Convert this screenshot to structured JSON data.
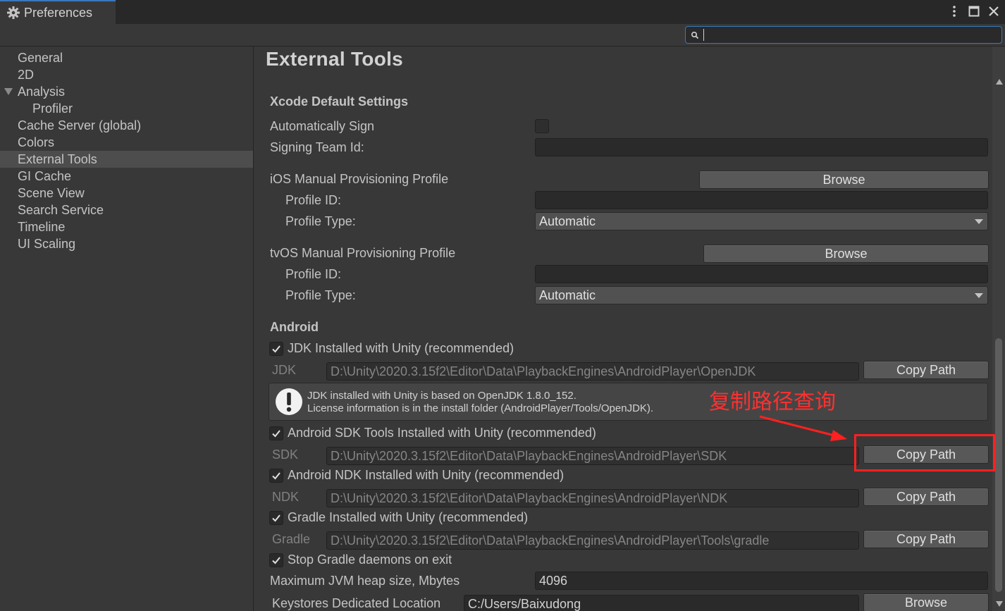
{
  "window": {
    "tab_title": "Preferences",
    "icons": [
      "gear-icon",
      "kebab-menu-icon",
      "maximize-icon",
      "close-icon"
    ]
  },
  "search": {
    "value": "",
    "placeholder": ""
  },
  "sidebar": {
    "items": [
      {
        "label": "General"
      },
      {
        "label": "2D"
      },
      {
        "label": "Analysis"
      },
      {
        "label": "Profiler"
      },
      {
        "label": "Cache Server (global)"
      },
      {
        "label": "Colors"
      },
      {
        "label": "External Tools"
      },
      {
        "label": "GI Cache"
      },
      {
        "label": "Scene View"
      },
      {
        "label": "Search Service"
      },
      {
        "label": "Timeline"
      },
      {
        "label": "UI Scaling"
      }
    ],
    "selected": "External Tools"
  },
  "main": {
    "title": "External Tools",
    "xcode": {
      "header": "Xcode Default Settings",
      "auto_sign_label": "Automatically Sign",
      "auto_sign_checked": false,
      "team_id_label": "Signing Team Id:",
      "team_id_value": "",
      "ios_profile_label": "iOS Manual Provisioning Profile",
      "ios_browse": "Browse",
      "ios_profile_id_label": "Profile ID:",
      "ios_profile_id_value": "",
      "ios_profile_type_label": "Profile Type:",
      "ios_profile_type_value": "Automatic",
      "tvos_profile_label": "tvOS Manual Provisioning Profile",
      "tvos_browse": "Browse",
      "tvos_profile_id_label": "Profile ID:",
      "tvos_profile_id_value": "",
      "tvos_profile_type_label": "Profile Type:",
      "tvos_profile_type_value": "Automatic"
    },
    "android": {
      "header": "Android",
      "jdk_check_label": "JDK Installed with Unity (recommended)",
      "jdk_checked": true,
      "jdk_label": "JDK",
      "jdk_path": "D:\\Unity\\2020.3.15f2\\Editor\\Data\\PlaybackEngines\\AndroidPlayer\\OpenJDK",
      "jdk_copy": "Copy Path",
      "help_line1": "JDK installed with Unity is based on OpenJDK 1.8.0_152.",
      "help_line2": "License information is in the install folder (AndroidPlayer/Tools/OpenJDK).",
      "sdk_check_label": "Android SDK Tools Installed with Unity (recommended)",
      "sdk_checked": true,
      "sdk_label": "SDK",
      "sdk_path": "D:\\Unity\\2020.3.15f2\\Editor\\Data\\PlaybackEngines\\AndroidPlayer\\SDK",
      "sdk_copy": "Copy Path",
      "ndk_check_label": "Android NDK Installed with Unity (recommended)",
      "ndk_checked": true,
      "ndk_label": "NDK",
      "ndk_path": "D:\\Unity\\2020.3.15f2\\Editor\\Data\\PlaybackEngines\\AndroidPlayer\\NDK",
      "ndk_copy": "Copy Path",
      "gradle_check_label": "Gradle Installed with Unity (recommended)",
      "gradle_checked": true,
      "gradle_label": "Gradle",
      "gradle_path": "D:\\Unity\\2020.3.15f2\\Editor\\Data\\PlaybackEngines\\AndroidPlayer\\Tools\\gradle",
      "gradle_copy": "Copy Path",
      "stop_gradle_label": "Stop Gradle daemons on exit",
      "stop_gradle_checked": true,
      "jvm_label": "Maximum JVM heap size, Mbytes",
      "jvm_value": "4096",
      "keystore_label": "Keystores Dedicated Location",
      "keystore_value": "C:/Users/Baixudong",
      "keystore_browse": "Browse"
    }
  },
  "annotation": {
    "text": "复制路径查询",
    "color": "#ff2020"
  }
}
